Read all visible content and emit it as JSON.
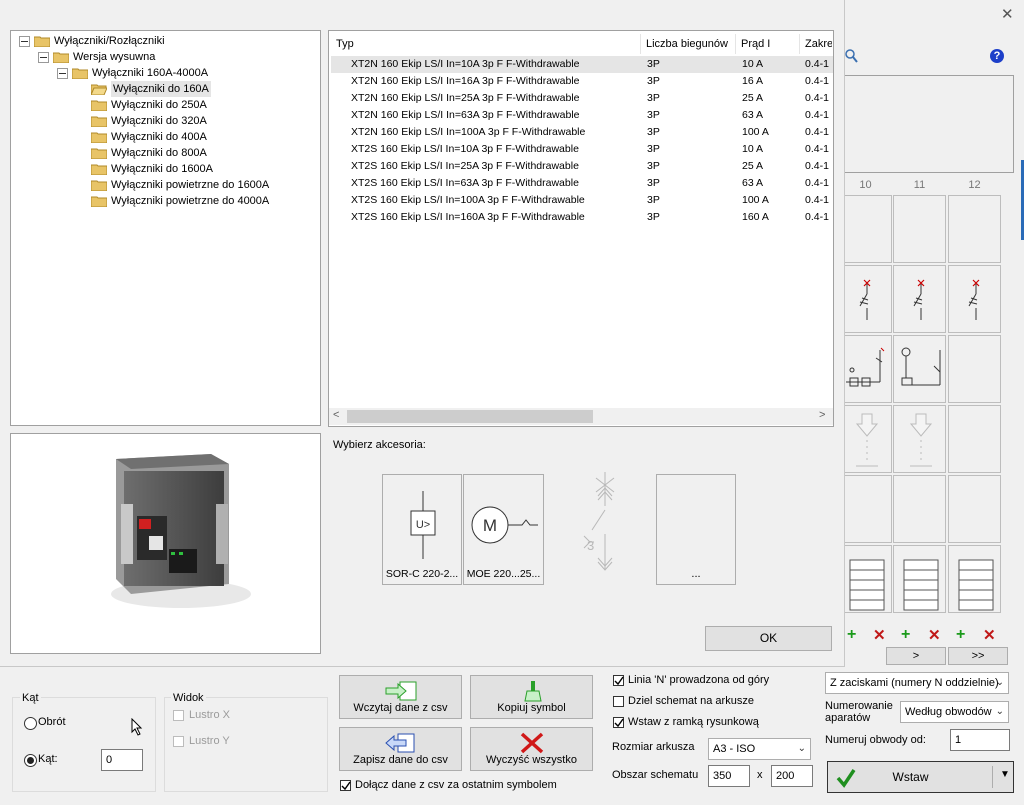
{
  "window": {
    "close_glyph": "✕",
    "help_glyph": "?"
  },
  "tree": {
    "root": "Wyłączniki/Rozłączniki",
    "level1": "Wersja wysuwna",
    "level2": "Wyłączniki 160A-4000A",
    "items": [
      "Wyłączniki do 160A",
      "Wyłączniki do 250A",
      "Wyłączniki do 320A",
      "Wyłączniki do 400A",
      "Wyłączniki do 800A",
      "Wyłączniki do 1600A",
      "Wyłączniki powietrzne do 1600A",
      "Wyłączniki powietrzne do 4000A"
    ]
  },
  "table": {
    "columns": [
      "Typ",
      "Liczba biegunów",
      "Prąd I",
      "Zakre"
    ],
    "rows": [
      [
        "XT2N 160 Ekip LS/I In=10A 3p F F-Withdrawable",
        "3P",
        "10 A",
        "0.4-1"
      ],
      [
        "XT2N 160 Ekip LS/I In=16A 3p F F-Withdrawable",
        "3P",
        "16 A",
        "0.4-1"
      ],
      [
        "XT2N 160 Ekip LS/I In=25A 3p F F-Withdrawable",
        "3P",
        "25 A",
        "0.4-1"
      ],
      [
        "XT2N 160 Ekip LS/I In=63A 3p F F-Withdrawable",
        "3P",
        "63 A",
        "0.4-1"
      ],
      [
        "XT2N 160 Ekip LS/I In=100A 3p F F-Withdrawable",
        "3P",
        "100 A",
        "0.4-1"
      ],
      [
        "XT2S 160 Ekip LS/I In=10A 3p F F-Withdrawable",
        "3P",
        "10 A",
        "0.4-1"
      ],
      [
        "XT2S 160 Ekip LS/I In=25A 3p F F-Withdrawable",
        "3P",
        "25 A",
        "0.4-1"
      ],
      [
        "XT2S 160 Ekip LS/I In=63A 3p F F-Withdrawable",
        "3P",
        "63 A",
        "0.4-1"
      ],
      [
        "XT2S 160 Ekip LS/I In=100A 3p F F-Withdrawable",
        "3P",
        "100 A",
        "0.4-1"
      ],
      [
        "XT2S 160 Ekip LS/I In=160A 3p F F-Withdrawable",
        "3P",
        "160 A",
        "0.4-1"
      ]
    ]
  },
  "accessories": {
    "label": "Wybierz akcesoria:",
    "items": [
      "SOR-C 220-2...",
      "MOE 220...25...",
      "..."
    ]
  },
  "ok_label": "OK",
  "grid": {
    "columns": [
      "10",
      "11",
      "12"
    ],
    "nav": [
      ">",
      ">>"
    ]
  },
  "kat_group": {
    "title": "Kąt",
    "obrot_label": "Obrót",
    "kat_label": "Kąt:",
    "kat_value": "0"
  },
  "widok_group": {
    "title": "Widok",
    "lustro_x": "Lustro X",
    "lustro_y": "Lustro Y"
  },
  "csv": {
    "load_label": "Wczytaj dane z csv",
    "copy_label": "Kopiuj symbol",
    "save_label": "Zapisz dane do csv",
    "clear_label": "Wyczyść wszystko",
    "append_label": "Dołącz dane z csv za ostatnim symbolem"
  },
  "options": {
    "linia_n": "Linia 'N' prowadzona od góry",
    "dziel": "Dziel schemat na arkusze",
    "wstaw_ramka": "Wstaw z ramką rysunkową",
    "rozmiar_label": "Rozmiar arkusza",
    "rozmiar_value": "A3 - ISO",
    "obszar_label": "Obszar schematu",
    "obszar_w": "350",
    "obszar_x": "x",
    "obszar_h": "200"
  },
  "right_options": {
    "zaciski_value": "Z zaciskami (numery N oddzielnie)",
    "numerowanie_label": "Numerowanie aparatów",
    "numerowanie_value": "Według obwodów",
    "numeruj_label": "Numeruj obwody od:",
    "numeruj_value": "1",
    "insert_label": "Wstaw"
  }
}
